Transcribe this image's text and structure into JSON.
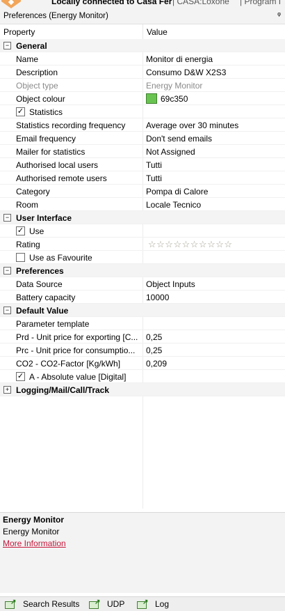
{
  "topbar": {
    "context": "Locally connected to Casa Fer",
    "tab2": "|   CASA:Loxone",
    "tab3": "|   Program I"
  },
  "panel": {
    "title": "Preferences (Energy Monitor)",
    "pin": "ᵠ"
  },
  "columns": {
    "property": "Property",
    "value": "Value"
  },
  "rows": {
    "general": "General",
    "name": {
      "label": "Name",
      "value": "Monitor di energia"
    },
    "description": {
      "label": "Description",
      "value": "Consumo D&W X2S3"
    },
    "object_type": {
      "label": "Object type",
      "value": "Energy Monitor"
    },
    "object_colour": {
      "label": "Object colour",
      "value": "69c350",
      "color": "#69c350"
    },
    "statistics": {
      "label": "Statistics",
      "checked": "✓"
    },
    "stat_freq": {
      "label": "Statistics recording frequency",
      "value": "Average over 30 minutes"
    },
    "email_freq": {
      "label": "Email frequency",
      "value": "Don't send emails"
    },
    "mailer": {
      "label": "Mailer for statistics",
      "value": "Not Assigned"
    },
    "auth_local": {
      "label": "Authorised local users",
      "value": "Tutti"
    },
    "auth_remote": {
      "label": "Authorised remote users",
      "value": "Tutti"
    },
    "category": {
      "label": "Category",
      "value": "Pompa di Calore"
    },
    "room": {
      "label": "Room",
      "value": "Locale Tecnico"
    },
    "ui": "User Interface",
    "use": {
      "label": "Use",
      "checked": "✓"
    },
    "rating": {
      "label": "Rating",
      "stars": "☆☆☆☆☆☆☆☆☆☆"
    },
    "use_fav": {
      "label": "Use as Favourite",
      "checked": ""
    },
    "prefs": "Preferences",
    "data_source": {
      "label": "Data Source",
      "value": "Object Inputs"
    },
    "battery": {
      "label": "Battery capacity",
      "value": "10000"
    },
    "default_value": "Default Value",
    "param_template": {
      "label": "Parameter template",
      "value": ""
    },
    "prd": {
      "label": "Prd - Unit price for exporting [C...",
      "value": "0,25"
    },
    "prc": {
      "label": "Prc - Unit price for consumptio...",
      "value": "0,25"
    },
    "co2": {
      "label": "CO2 - CO2-Factor  [Kg/kWh]",
      "value": "0,209"
    },
    "abs": {
      "label": "A - Absolute value [Digital]",
      "checked": "✓"
    },
    "logging": "Logging/Mail/Call/Track",
    "toggle_minus": "−",
    "toggle_plus": "+"
  },
  "info": {
    "title": "Energy Monitor",
    "subtitle": "Energy Monitor",
    "link": "More Information"
  },
  "bottom_tabs": [
    "Search Results",
    "UDP",
    "Log"
  ],
  "colors": {
    "accent_link": "#c5183b",
    "swatch": "#69c350",
    "app_icon": "#f2a65a"
  }
}
